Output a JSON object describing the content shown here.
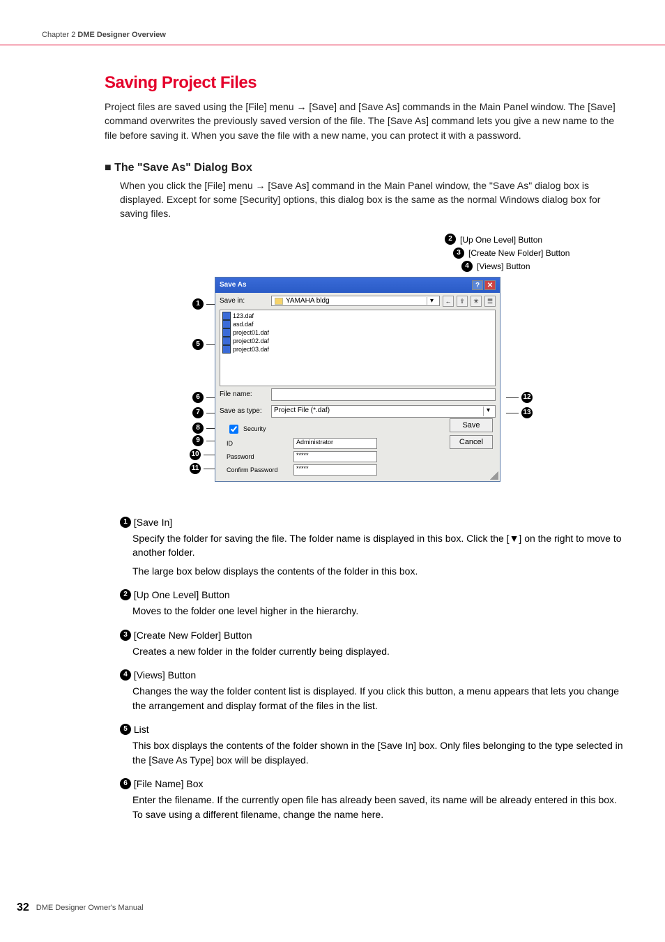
{
  "header": {
    "chapter": "Chapter 2  ",
    "title_bold": "DME Designer Overview"
  },
  "h1": "Saving Project Files",
  "intro": "Project files are saved using the [File] menu → [Save] and [Save As] commands in the Main Panel window. The [Save] command overwrites the previously saved version of the file. The [Save As] command lets you give a new name to the file before saving it. When you save the file with a new name, you can protect it with a password.",
  "section_title": "The \"Save As\" Dialog Box",
  "section_body": "When you click the [File] menu → [Save As] command in the Main Panel window, the \"Save As\" dialog box is displayed. Except for some [Security] options, this dialog box is the same as the normal Windows dialog box for saving files.",
  "top_callouts": {
    "c2": "[Up One Level] Button",
    "c3": "[Create New Folder] Button",
    "c4": "[Views] Button"
  },
  "dialog": {
    "title": "Save As",
    "save_in_lbl": "Save in:",
    "folder": "YAMAHA bldg",
    "files": [
      "123.daf",
      "asd.daf",
      "project01.daf",
      "project02.daf",
      "project03.daf"
    ],
    "file_name_lbl": "File name:",
    "file_name_val": "",
    "save_type_lbl": "Save as type:",
    "save_type_val": "Project File (*.daf)",
    "save_btn": "Save",
    "cancel_btn": "Cancel",
    "security_lbl": "Security",
    "id_lbl": "ID",
    "id_val": "Administrator",
    "pw_lbl": "Password",
    "pw_val": "*****",
    "cpw_lbl": "Confirm Password",
    "cpw_val": "*****"
  },
  "items": {
    "i1_h": "[Save In]",
    "i1_b1": "Specify the folder for saving the file. The folder name is displayed in this box. Click the [▼] on the right to move to another folder.",
    "i1_b2": "The large box below displays the contents of the folder in this box.",
    "i2_h": "[Up One Level] Button",
    "i2_b": "Moves to the folder one level higher in the hierarchy.",
    "i3_h": "[Create New Folder] Button",
    "i3_b": "Creates a new folder in the folder currently being displayed.",
    "i4_h": "[Views] Button",
    "i4_b": "Changes the way the folder content list is displayed. If you click this button, a menu appears that lets you change the arrangement and display format of the files in the list.",
    "i5_h": "List",
    "i5_b": "This box displays the contents of the folder shown in the [Save In] box. Only files belonging to the type selected in the [Save As Type] box will be displayed.",
    "i6_h": "[File Name] Box",
    "i6_b": "Enter the filename. If the currently open file has already been saved, its name will be already entered in this box. To save using a different filename, change the name here."
  },
  "footer": {
    "page": "32",
    "manual": "DME Designer Owner's Manual"
  }
}
